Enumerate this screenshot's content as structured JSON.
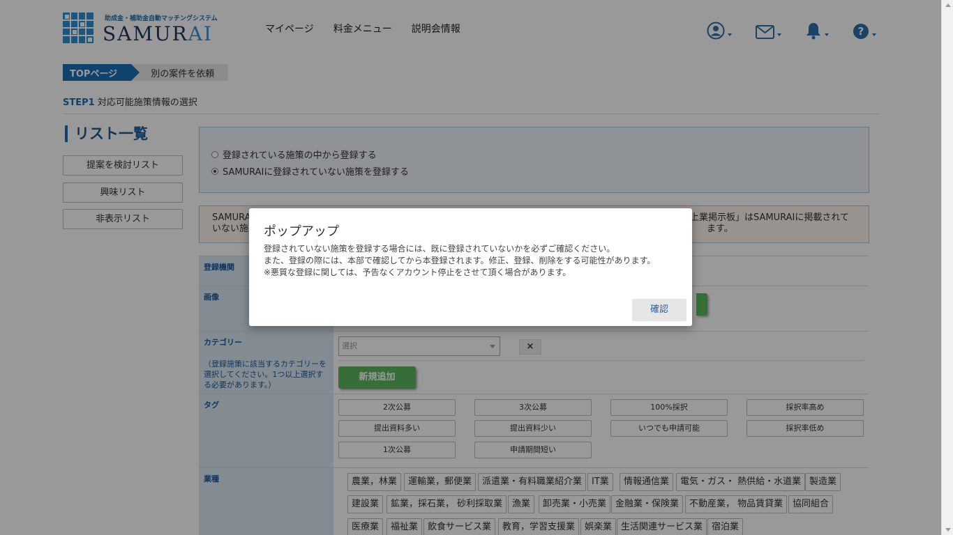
{
  "header": {
    "logo_tagline": "助成金・補助金自動マッチングシステム",
    "logo_text_main": "SAMUR",
    "logo_text_accent": "AI",
    "nav": [
      "マイページ",
      "料金メニュー",
      "説明会情報"
    ],
    "icons": [
      "user-icon",
      "mail-icon",
      "bell-icon",
      "help-icon"
    ]
  },
  "breadcrumb": {
    "top": "TOPページ",
    "current": "別の案件を依頼"
  },
  "step": {
    "label": "STEP1",
    "text": "対応可能施策情報の選択"
  },
  "sidebar": {
    "title": "リスト一覧",
    "items": [
      "提案を検討リスト",
      "興味リスト",
      "非表示リスト"
    ]
  },
  "registration": {
    "options": [
      "登録されている施策の中から登録する",
      "SAMURAIに登録されていない施策を登録する"
    ],
    "selected_index": 1
  },
  "notice": {
    "line1_left": "SAMURA",
    "line1_right": "上業掲示板」はSAMURAIに掲載されて",
    "line2_left": "いない施",
    "line2_right": "ます。"
  },
  "form": {
    "org_label": "登録機関",
    "image_label": "画像",
    "category_label": "カテゴリー",
    "category_help": "（登録施策に該当するカテゴリーを選択してください。1つ以上選択する必要があります。）",
    "category_select_placeholder": "選択",
    "remove_symbol": "×",
    "add_button": "新規追加",
    "tag_label": "タグ",
    "tags": [
      "2次公募",
      "3次公募",
      "100%採択",
      "採択率高め",
      "提出資料多い",
      "提出資料少い",
      "いつでも申請可能",
      "採択率低め",
      "1次公募",
      "申請期間短い"
    ],
    "industry_label": "業種",
    "industries": [
      "農業，林業",
      "運輸業，郵便業",
      "派遣業・有料職業紹介業",
      "IT業",
      "情報通信業",
      "電気・ガス・ 熱供給・水道業",
      "製造業",
      "建設業",
      "鉱業，採石業， 砂利採取業",
      "漁業",
      "卸売業・小売業",
      "金融業・保険業",
      "不動産業， 物品賃貸業",
      "協同組合",
      "医療業",
      "福祉業",
      "飲食サービス業",
      "教育，学習支援業",
      "娯楽業",
      "生活関連サービス業",
      "宿泊業"
    ]
  },
  "modal": {
    "title": "ポップアップ",
    "lines": [
      "登録されていない施策を登録する場合には、既に登録されていないかを必ずご確認ください。",
      "また、登録の際には、本部で確認してから本登録されます。修正、登録、削除をする可能性があります。",
      "※悪質な登録に関しては、予告なくアカウント停止をさせて頂く場合があります。"
    ],
    "confirm_button": "確認"
  },
  "colors": {
    "brand_blue": "#1c6fb8",
    "label_bg": "#dde9f5",
    "green": "#5cb85c"
  }
}
